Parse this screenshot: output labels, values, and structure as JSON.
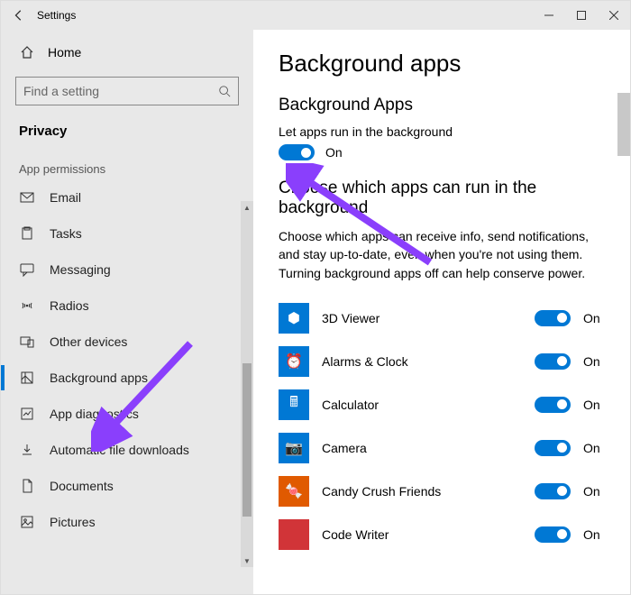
{
  "titlebar": {
    "title": "Settings"
  },
  "sidebar": {
    "home_label": "Home",
    "search_placeholder": "Find a setting",
    "section": "Privacy",
    "group": "App permissions",
    "items": [
      {
        "icon": "mail-icon",
        "label": "Email"
      },
      {
        "icon": "clipboard-icon",
        "label": "Tasks"
      },
      {
        "icon": "chat-icon",
        "label": "Messaging"
      },
      {
        "icon": "radio-icon",
        "label": "Radios"
      },
      {
        "icon": "devices-icon",
        "label": "Other devices"
      },
      {
        "icon": "background-icon",
        "label": "Background apps"
      },
      {
        "icon": "diagnostics-icon",
        "label": "App diagnostics"
      },
      {
        "icon": "download-icon",
        "label": "Automatic file downloads"
      },
      {
        "icon": "document-icon",
        "label": "Documents"
      },
      {
        "icon": "picture-icon",
        "label": "Pictures"
      }
    ],
    "selected_index": 5
  },
  "main": {
    "heading": "Background apps",
    "section1_title": "Background Apps",
    "master_label": "Let apps run in the background",
    "master_state": "On",
    "section2_title": "Choose which apps can run in the background",
    "description": "Choose which apps can receive info, send notifications, and stay up-to-date, even when you're not using them. Turning background apps off can help conserve power.",
    "apps": [
      {
        "name": "3D Viewer",
        "state": "On",
        "color": "#0078d4",
        "glyph": "⬢"
      },
      {
        "name": "Alarms & Clock",
        "state": "On",
        "color": "#0078d4",
        "glyph": "⏰"
      },
      {
        "name": "Calculator",
        "state": "On",
        "color": "#0078d4",
        "glyph": "🖩"
      },
      {
        "name": "Camera",
        "state": "On",
        "color": "#0078d4",
        "glyph": "📷"
      },
      {
        "name": "Candy Crush Friends",
        "state": "On",
        "color": "#e05a00",
        "glyph": "🍬"
      },
      {
        "name": "Code Writer",
        "state": "On",
        "color": "#d13438",
        "glyph": "</>"
      }
    ]
  }
}
